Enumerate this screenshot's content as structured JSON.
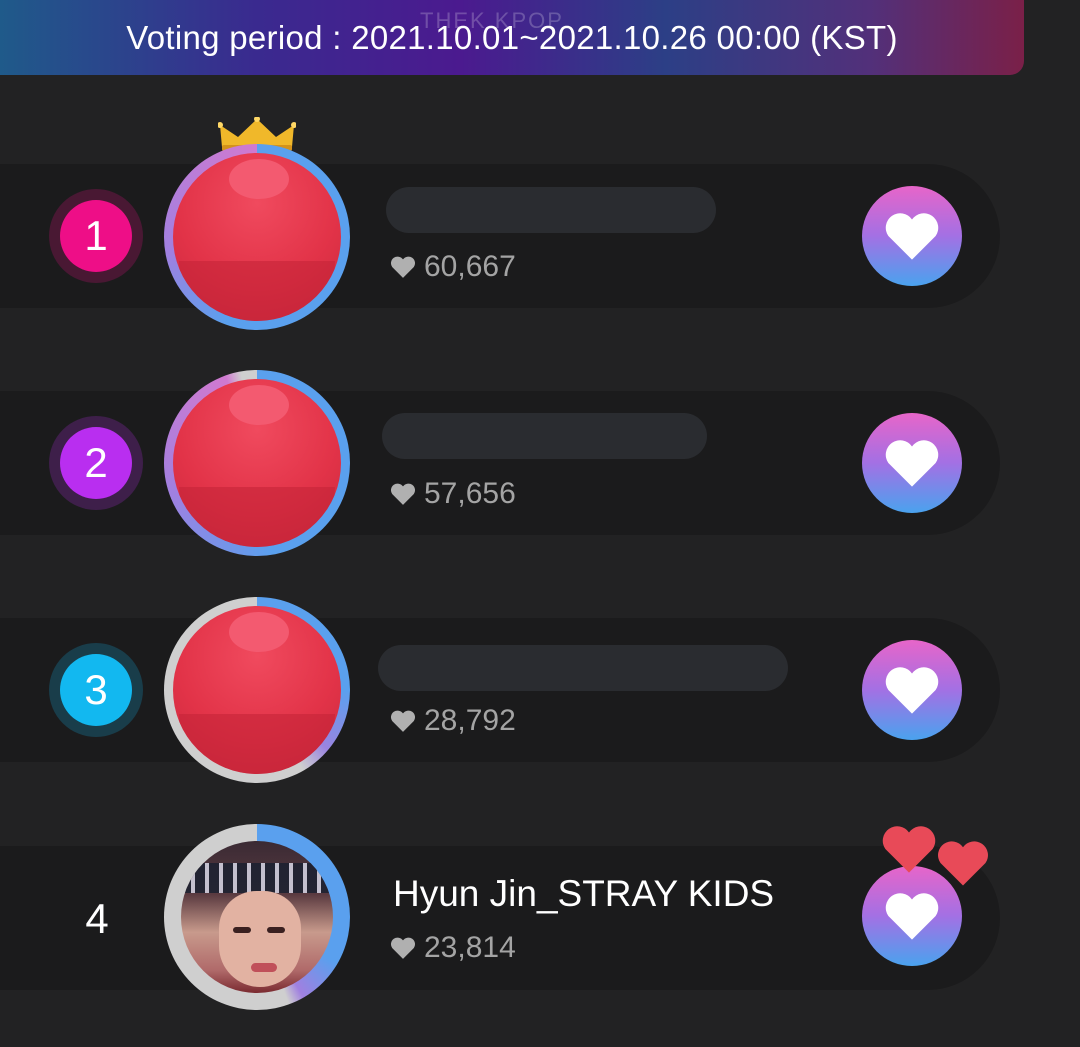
{
  "banner": {
    "text": "Voting period : 2021.10.01~2021.10.26 00:00 (KST)",
    "watermark": "THEK   KPOP"
  },
  "ranking": [
    {
      "rank": "1",
      "name": "",
      "votes": "60,667",
      "badge_color": "#ee0e87"
    },
    {
      "rank": "2",
      "name": "",
      "votes": "57,656",
      "badge_color": "#b92ef0"
    },
    {
      "rank": "3",
      "name": "",
      "votes": "28,792",
      "badge_color": "#12b8f0"
    },
    {
      "rank": "4",
      "name": "Hyun Jin_STRAY KIDS",
      "votes": "23,814",
      "badge_color": ""
    }
  ],
  "icons": {
    "vote": "heart-icon",
    "count": "heart-icon",
    "top": "crown-icon"
  },
  "colors": {
    "background": "#222223",
    "row": "#1b1b1c",
    "accent_pink": "#e765c9",
    "accent_blue": "#4aa2ee",
    "heart_float": "#e84a58"
  }
}
